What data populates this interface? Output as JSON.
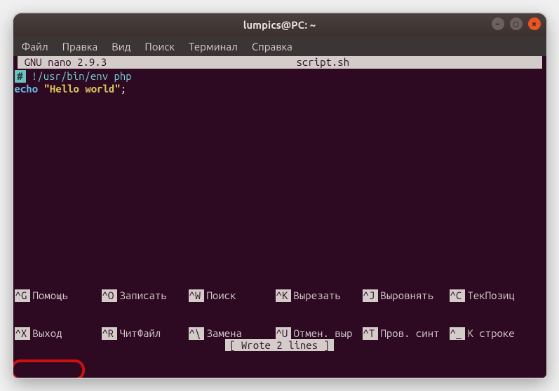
{
  "window": {
    "title": "lumpics@PC: ~"
  },
  "menu": {
    "items": [
      "Файл",
      "Правка",
      "Вид",
      "Поиск",
      "Терминал",
      "Справка"
    ]
  },
  "nano": {
    "version_label": "GNU nano 2.9.3",
    "filename": "script.sh",
    "code": {
      "line1_comment": " !/usr/bin/env php",
      "line2_keyword": "echo",
      "line2_string": "\"Hello world\"",
      "line2_tail": ";"
    },
    "status": "[ Wrote 2 lines ]",
    "shortcuts_row1": [
      {
        "key": "^G",
        "label": "Помощь"
      },
      {
        "key": "^O",
        "label": "Записать"
      },
      {
        "key": "^W",
        "label": "Поиск"
      },
      {
        "key": "^K",
        "label": "Вырезать"
      },
      {
        "key": "^J",
        "label": "Выровнять"
      },
      {
        "key": "^C",
        "label": "ТекПозиц"
      }
    ],
    "shortcuts_row2": [
      {
        "key": "^X",
        "label": "Выход"
      },
      {
        "key": "^R",
        "label": "ЧитФайл"
      },
      {
        "key": "^\\",
        "label": "Замена"
      },
      {
        "key": "^U",
        "label": "Отмен. выр"
      },
      {
        "key": "^T",
        "label": "Пров. синт"
      },
      {
        "key": "^_",
        "label": "К строке"
      }
    ]
  }
}
